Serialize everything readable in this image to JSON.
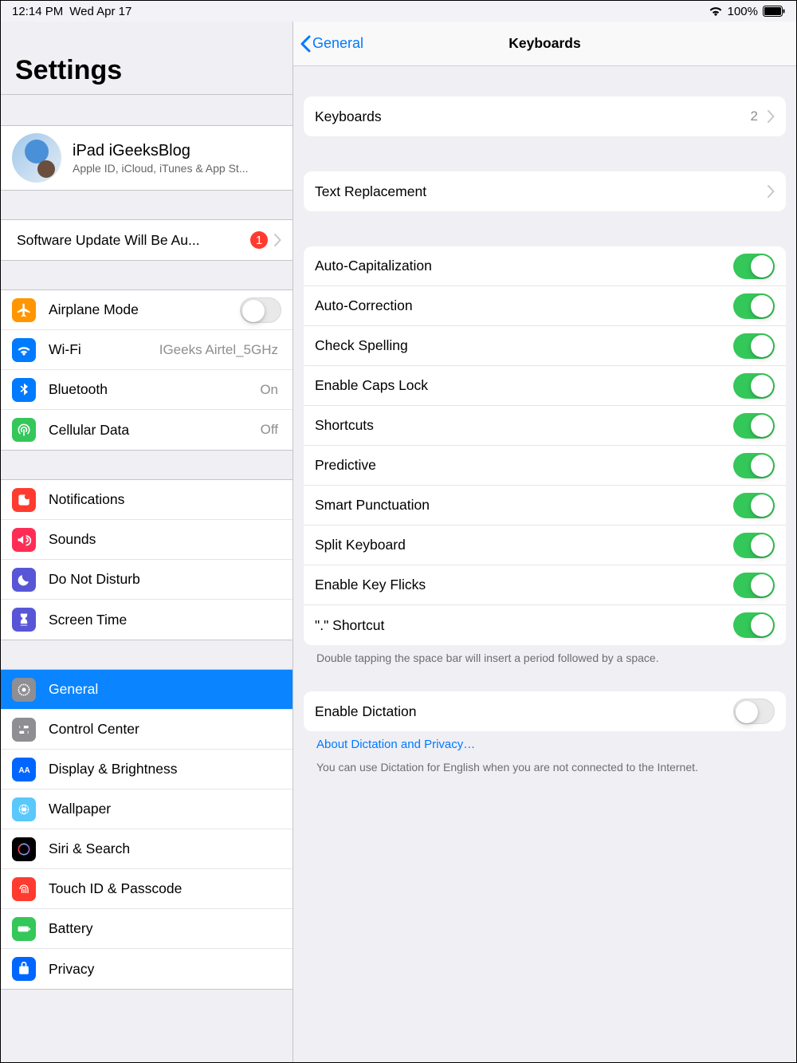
{
  "status": {
    "time": "12:14 PM",
    "date": "Wed Apr 17",
    "battery": "100%"
  },
  "sidebar": {
    "title": "Settings",
    "account": {
      "name": "iPad iGeeksBlog",
      "sub": "Apple ID, iCloud, iTunes & App St..."
    },
    "update": {
      "label": "Software Update Will Be Au...",
      "badge": "1"
    },
    "net": {
      "airplane": "Airplane Mode",
      "wifi": "Wi-Fi",
      "wifi_val": "IGeeks Airtel_5GHz",
      "bt": "Bluetooth",
      "bt_val": "On",
      "cell": "Cellular Data",
      "cell_val": "Off"
    },
    "alerts": {
      "notif": "Notifications",
      "sounds": "Sounds",
      "dnd": "Do Not Disturb",
      "st": "Screen Time"
    },
    "sys": {
      "general": "General",
      "cc": "Control Center",
      "disp": "Display & Brightness",
      "wall": "Wallpaper",
      "siri": "Siri & Search",
      "touch": "Touch ID & Passcode",
      "batt": "Battery",
      "priv": "Privacy"
    }
  },
  "detail": {
    "back": "General",
    "title": "Keyboards",
    "row_keyboards": {
      "label": "Keyboards",
      "value": "2"
    },
    "row_textrepl": {
      "label": "Text Replacement"
    },
    "toggles": [
      {
        "label": "Auto-Capitalization",
        "on": true
      },
      {
        "label": "Auto-Correction",
        "on": true
      },
      {
        "label": "Check Spelling",
        "on": true
      },
      {
        "label": "Enable Caps Lock",
        "on": true
      },
      {
        "label": "Shortcuts",
        "on": true
      },
      {
        "label": "Predictive",
        "on": true
      },
      {
        "label": "Smart Punctuation",
        "on": true
      },
      {
        "label": "Split Keyboard",
        "on": true
      },
      {
        "label": "Enable Key Flicks",
        "on": true
      },
      {
        "label": "\".\" Shortcut",
        "on": true
      }
    ],
    "toggles_footer": "Double tapping the space bar will insert a period followed by a space.",
    "dictation": {
      "label": "Enable Dictation",
      "on": false
    },
    "dictation_link": "About Dictation and Privacy…",
    "dictation_footer": "You can use Dictation for English when you are not connected to the Internet."
  }
}
